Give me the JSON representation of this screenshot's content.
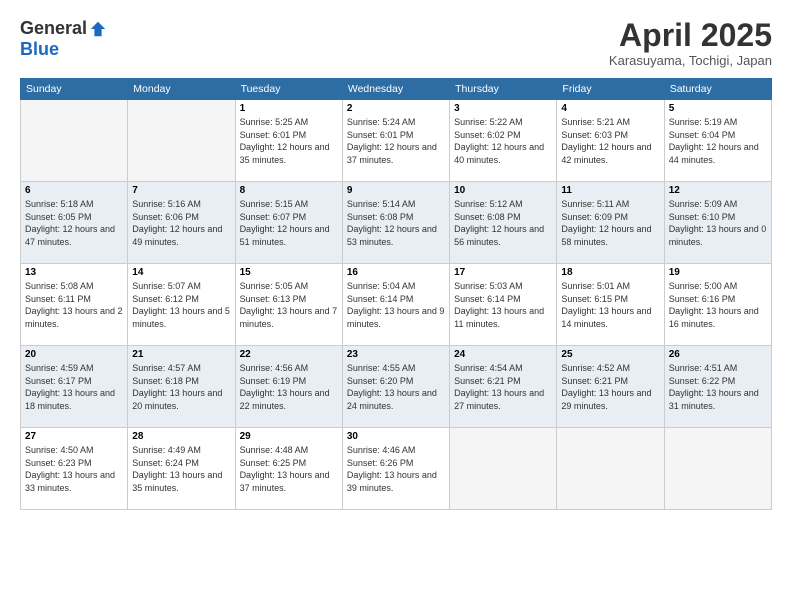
{
  "header": {
    "logo_general": "General",
    "logo_blue": "Blue",
    "title": "April 2025",
    "location": "Karasuyama, Tochigi, Japan"
  },
  "weekdays": [
    "Sunday",
    "Monday",
    "Tuesday",
    "Wednesday",
    "Thursday",
    "Friday",
    "Saturday"
  ],
  "weeks": [
    [
      {
        "day": "",
        "info": ""
      },
      {
        "day": "",
        "info": ""
      },
      {
        "day": "1",
        "info": "Sunrise: 5:25 AM\nSunset: 6:01 PM\nDaylight: 12 hours\nand 35 minutes."
      },
      {
        "day": "2",
        "info": "Sunrise: 5:24 AM\nSunset: 6:01 PM\nDaylight: 12 hours\nand 37 minutes."
      },
      {
        "day": "3",
        "info": "Sunrise: 5:22 AM\nSunset: 6:02 PM\nDaylight: 12 hours\nand 40 minutes."
      },
      {
        "day": "4",
        "info": "Sunrise: 5:21 AM\nSunset: 6:03 PM\nDaylight: 12 hours\nand 42 minutes."
      },
      {
        "day": "5",
        "info": "Sunrise: 5:19 AM\nSunset: 6:04 PM\nDaylight: 12 hours\nand 44 minutes."
      }
    ],
    [
      {
        "day": "6",
        "info": "Sunrise: 5:18 AM\nSunset: 6:05 PM\nDaylight: 12 hours\nand 47 minutes."
      },
      {
        "day": "7",
        "info": "Sunrise: 5:16 AM\nSunset: 6:06 PM\nDaylight: 12 hours\nand 49 minutes."
      },
      {
        "day": "8",
        "info": "Sunrise: 5:15 AM\nSunset: 6:07 PM\nDaylight: 12 hours\nand 51 minutes."
      },
      {
        "day": "9",
        "info": "Sunrise: 5:14 AM\nSunset: 6:08 PM\nDaylight: 12 hours\nand 53 minutes."
      },
      {
        "day": "10",
        "info": "Sunrise: 5:12 AM\nSunset: 6:08 PM\nDaylight: 12 hours\nand 56 minutes."
      },
      {
        "day": "11",
        "info": "Sunrise: 5:11 AM\nSunset: 6:09 PM\nDaylight: 12 hours\nand 58 minutes."
      },
      {
        "day": "12",
        "info": "Sunrise: 5:09 AM\nSunset: 6:10 PM\nDaylight: 13 hours\nand 0 minutes."
      }
    ],
    [
      {
        "day": "13",
        "info": "Sunrise: 5:08 AM\nSunset: 6:11 PM\nDaylight: 13 hours\nand 2 minutes."
      },
      {
        "day": "14",
        "info": "Sunrise: 5:07 AM\nSunset: 6:12 PM\nDaylight: 13 hours\nand 5 minutes."
      },
      {
        "day": "15",
        "info": "Sunrise: 5:05 AM\nSunset: 6:13 PM\nDaylight: 13 hours\nand 7 minutes."
      },
      {
        "day": "16",
        "info": "Sunrise: 5:04 AM\nSunset: 6:14 PM\nDaylight: 13 hours\nand 9 minutes."
      },
      {
        "day": "17",
        "info": "Sunrise: 5:03 AM\nSunset: 6:14 PM\nDaylight: 13 hours\nand 11 minutes."
      },
      {
        "day": "18",
        "info": "Sunrise: 5:01 AM\nSunset: 6:15 PM\nDaylight: 13 hours\nand 14 minutes."
      },
      {
        "day": "19",
        "info": "Sunrise: 5:00 AM\nSunset: 6:16 PM\nDaylight: 13 hours\nand 16 minutes."
      }
    ],
    [
      {
        "day": "20",
        "info": "Sunrise: 4:59 AM\nSunset: 6:17 PM\nDaylight: 13 hours\nand 18 minutes."
      },
      {
        "day": "21",
        "info": "Sunrise: 4:57 AM\nSunset: 6:18 PM\nDaylight: 13 hours\nand 20 minutes."
      },
      {
        "day": "22",
        "info": "Sunrise: 4:56 AM\nSunset: 6:19 PM\nDaylight: 13 hours\nand 22 minutes."
      },
      {
        "day": "23",
        "info": "Sunrise: 4:55 AM\nSunset: 6:20 PM\nDaylight: 13 hours\nand 24 minutes."
      },
      {
        "day": "24",
        "info": "Sunrise: 4:54 AM\nSunset: 6:21 PM\nDaylight: 13 hours\nand 27 minutes."
      },
      {
        "day": "25",
        "info": "Sunrise: 4:52 AM\nSunset: 6:21 PM\nDaylight: 13 hours\nand 29 minutes."
      },
      {
        "day": "26",
        "info": "Sunrise: 4:51 AM\nSunset: 6:22 PM\nDaylight: 13 hours\nand 31 minutes."
      }
    ],
    [
      {
        "day": "27",
        "info": "Sunrise: 4:50 AM\nSunset: 6:23 PM\nDaylight: 13 hours\nand 33 minutes."
      },
      {
        "day": "28",
        "info": "Sunrise: 4:49 AM\nSunset: 6:24 PM\nDaylight: 13 hours\nand 35 minutes."
      },
      {
        "day": "29",
        "info": "Sunrise: 4:48 AM\nSunset: 6:25 PM\nDaylight: 13 hours\nand 37 minutes."
      },
      {
        "day": "30",
        "info": "Sunrise: 4:46 AM\nSunset: 6:26 PM\nDaylight: 13 hours\nand 39 minutes."
      },
      {
        "day": "",
        "info": ""
      },
      {
        "day": "",
        "info": ""
      },
      {
        "day": "",
        "info": ""
      }
    ]
  ]
}
